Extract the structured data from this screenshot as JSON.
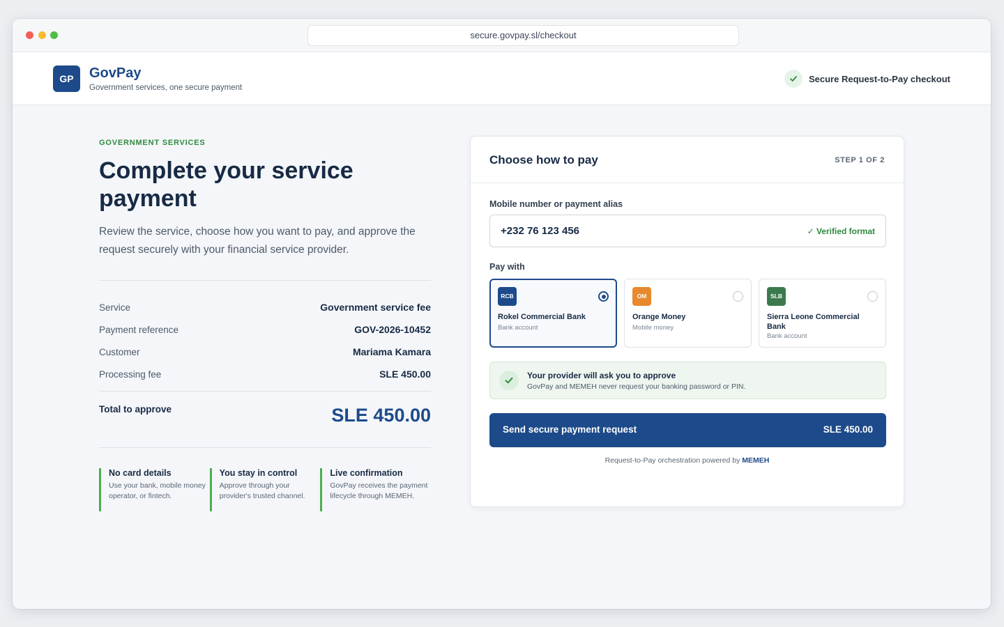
{
  "browser": {
    "url": "secure.govpay.sl/checkout"
  },
  "header": {
    "logo_initials": "GP",
    "brand_name": "GovPay",
    "tagline": "Government services, one secure payment",
    "secure_label": "Secure Request-to-Pay checkout"
  },
  "intro": {
    "eyebrow": "GOVERNMENT SERVICES",
    "title": "Complete your service payment",
    "lead": "Review the service, choose how you want to pay, and approve the request securely with your financial service provider."
  },
  "summary": {
    "rows": [
      {
        "label": "Service",
        "value": "Government service fee"
      },
      {
        "label": "Payment reference",
        "value": "GOV-2026-10452"
      },
      {
        "label": "Customer",
        "value": "Mariama Kamara"
      },
      {
        "label": "Processing fee",
        "value": "SLE 450.00"
      }
    ],
    "total_label": "Total to approve",
    "total_value": "SLE 450.00"
  },
  "features": [
    {
      "title": "No card details",
      "desc": "Use your bank, mobile money operator, or fintech."
    },
    {
      "title": "You stay in control",
      "desc": "Approve through your provider's trusted channel."
    },
    {
      "title": "Live confirmation",
      "desc": "GovPay receives the payment lifecycle through MEMEH."
    }
  ],
  "payment": {
    "title": "Choose how to pay",
    "step": "STEP 1 OF 2",
    "field_label": "Mobile number or payment alias",
    "field_value": "+232 76 123 456",
    "field_status": "✓ Verified format",
    "pay_with_label": "Pay with",
    "options": [
      {
        "badge": "RCB",
        "name": "Rokel Commercial Bank",
        "type": "Bank account",
        "color": "#1d4a8a",
        "selected": true
      },
      {
        "badge": "OM",
        "name": "Orange Money",
        "type": "Mobile money",
        "color": "#e8892e",
        "selected": false
      },
      {
        "badge": "SLB",
        "name": "Sierra Leone Commercial Bank",
        "type": "Bank account",
        "color": "#3c7a4e",
        "selected": false
      }
    ],
    "notice_title": "Your provider will ask you to approve",
    "notice_sub": "GovPay and MEMEH never request your banking password or PIN.",
    "cta_label": "Send secure payment request",
    "cta_amount": "SLE 450.00",
    "powered_prefix": "Request-to-Pay orchestration powered by",
    "powered_brand": "MEMEH"
  },
  "colors": {
    "primary": "#1d4a8a",
    "success": "#2f8a3c",
    "accent_bar": "#4caf50"
  }
}
